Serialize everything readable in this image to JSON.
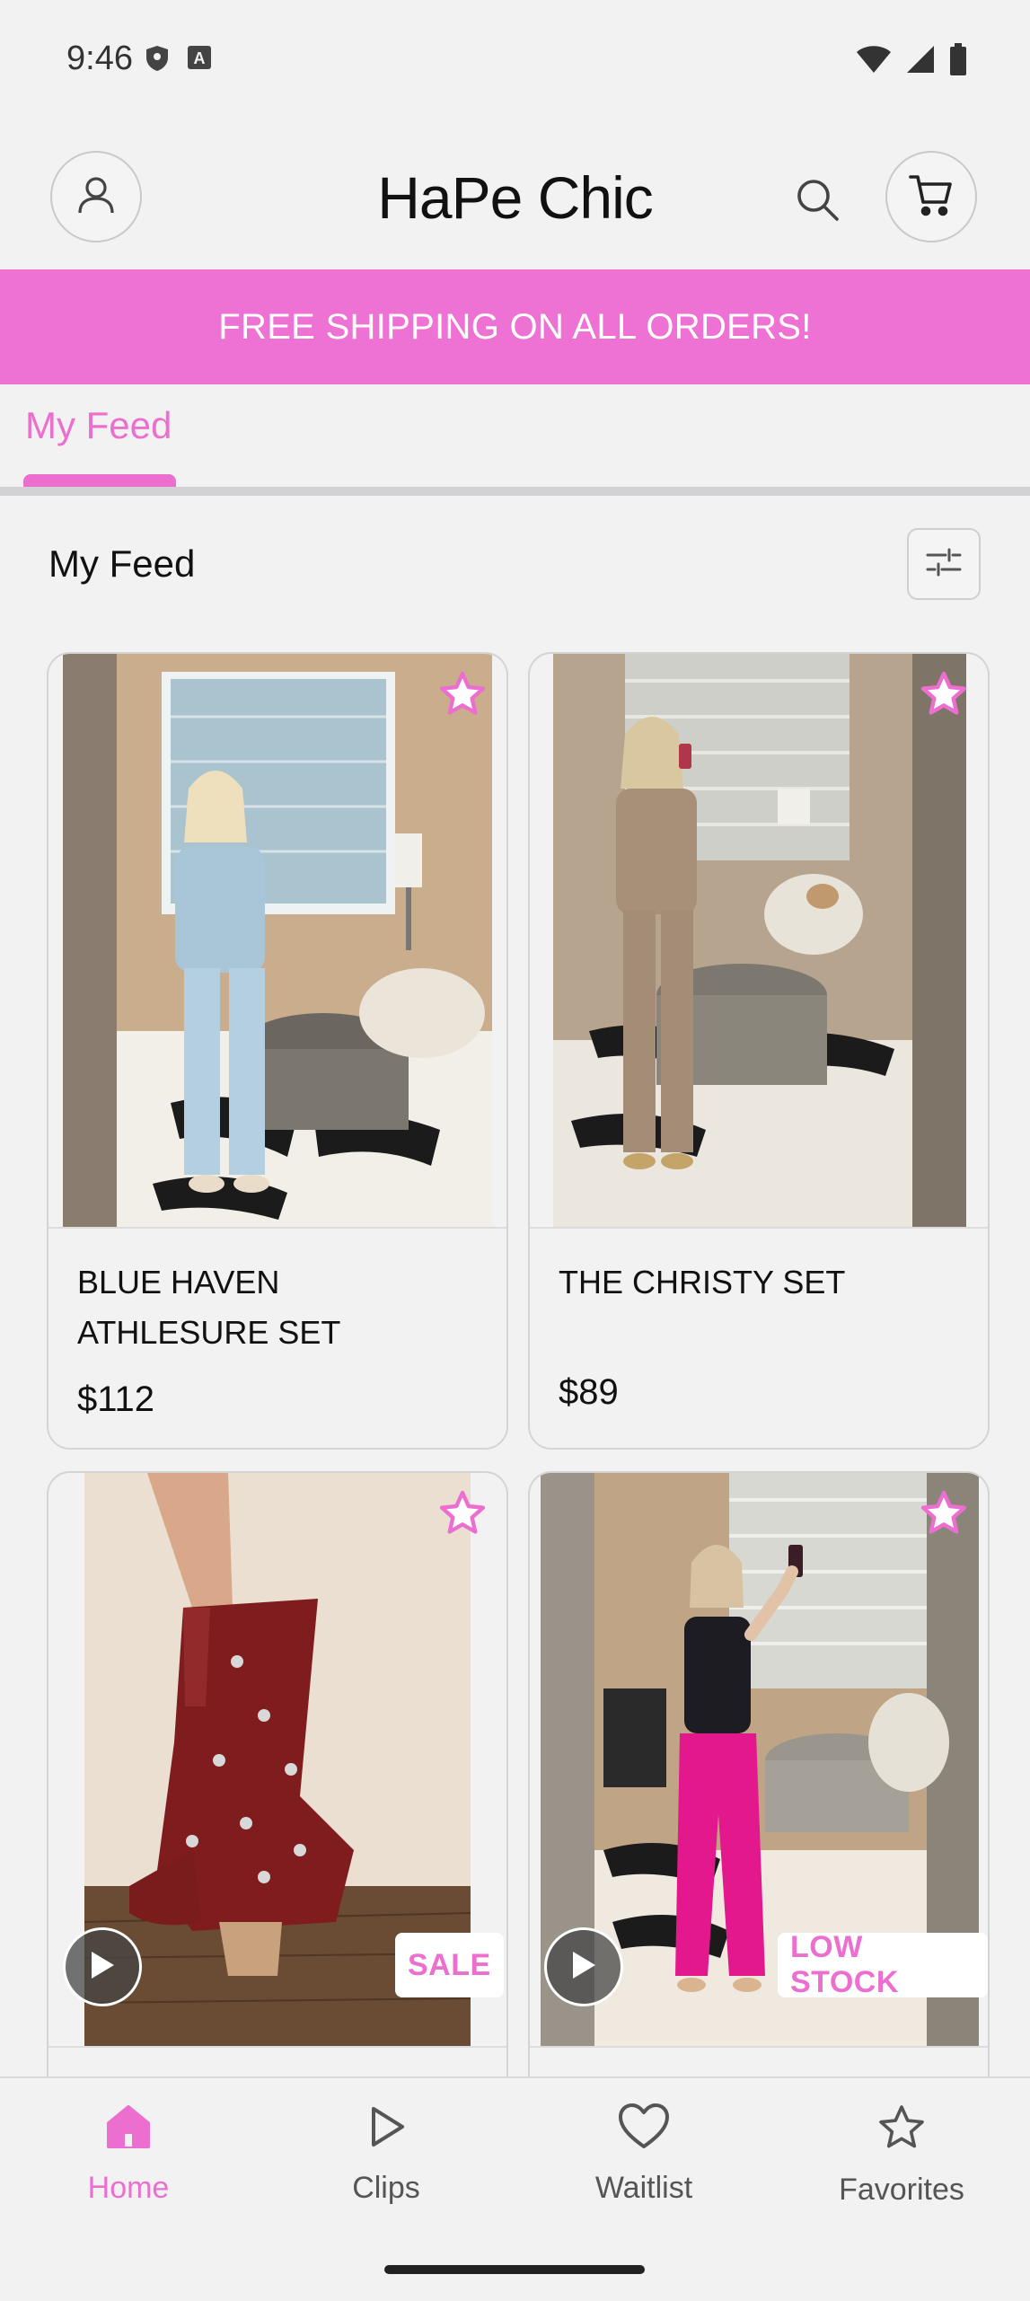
{
  "status_bar": {
    "time": "9:46",
    "left_icons": [
      "shield-icon",
      "a-icon"
    ],
    "right_icons": [
      "wifi-icon",
      "signal-icon",
      "battery-icon"
    ]
  },
  "header": {
    "brand": "HaPe Chic",
    "icons": [
      "profile-icon",
      "search-icon",
      "cart-icon"
    ]
  },
  "banner": {
    "text": "FREE SHIPPING ON ALL ORDERS!"
  },
  "tabs": [
    {
      "label": "My Feed",
      "active": true
    }
  ],
  "feed": {
    "title": "My Feed",
    "filter_icon": "filter-sliders-icon"
  },
  "products": [
    {
      "title": "BLUE HAVEN ATHLESURE SET",
      "price": "$112"
    },
    {
      "title": "THE CHRISTY SET",
      "price": "$89"
    },
    {
      "badge": "SALE"
    },
    {
      "badge": "LOW STOCK"
    }
  ],
  "bottom_nav": [
    {
      "label": "Home",
      "icon": "home-icon",
      "active": true
    },
    {
      "label": "Clips",
      "icon": "play-icon",
      "active": false
    },
    {
      "label": "Waitlist",
      "icon": "heart-icon",
      "active": false
    },
    {
      "label": "Favorites",
      "icon": "star-icon",
      "active": false
    }
  ],
  "colors": {
    "accent": "#ec6fcf",
    "banner": "#ee72d3",
    "background": "#f2f2f3"
  }
}
